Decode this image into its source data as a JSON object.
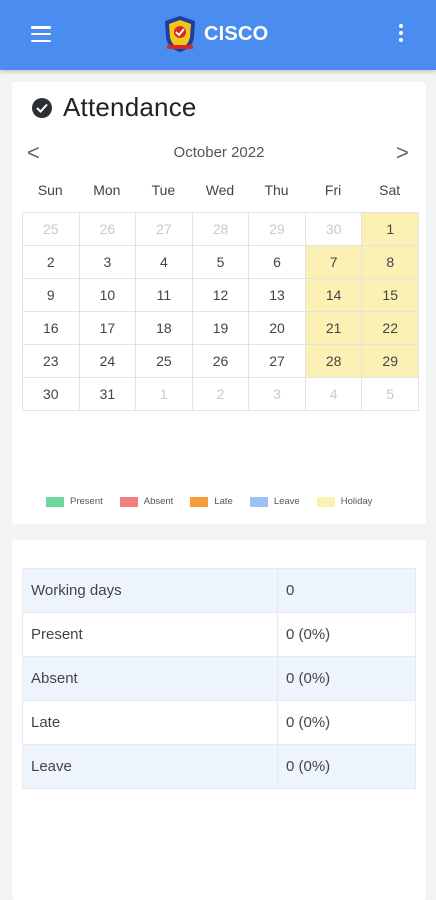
{
  "app": {
    "title": "CISCO"
  },
  "icons": {
    "menu": "hamburger-menu-icon",
    "more": "more-vert-icon",
    "logo": "school-crest-logo",
    "check": "check-circle-icon"
  },
  "attendance": {
    "title": "Attendance",
    "month_label": "October 2022",
    "prev": "<",
    "next": ">",
    "weekdays": [
      "Sun",
      "Mon",
      "Tue",
      "Wed",
      "Thu",
      "Fri",
      "Sat"
    ],
    "days": [
      {
        "d": "25",
        "out": true
      },
      {
        "d": "26",
        "out": true
      },
      {
        "d": "27",
        "out": true
      },
      {
        "d": "28",
        "out": true
      },
      {
        "d": "29",
        "out": true
      },
      {
        "d": "30",
        "out": true
      },
      {
        "d": "1",
        "holiday": true
      },
      {
        "d": "2"
      },
      {
        "d": "3"
      },
      {
        "d": "4"
      },
      {
        "d": "5"
      },
      {
        "d": "6"
      },
      {
        "d": "7",
        "holiday": true
      },
      {
        "d": "8",
        "holiday": true
      },
      {
        "d": "9"
      },
      {
        "d": "10"
      },
      {
        "d": "11"
      },
      {
        "d": "12"
      },
      {
        "d": "13"
      },
      {
        "d": "14",
        "holiday": true
      },
      {
        "d": "15",
        "holiday": true
      },
      {
        "d": "16"
      },
      {
        "d": "17"
      },
      {
        "d": "18"
      },
      {
        "d": "19"
      },
      {
        "d": "20"
      },
      {
        "d": "21",
        "holiday": true
      },
      {
        "d": "22",
        "holiday": true
      },
      {
        "d": "23"
      },
      {
        "d": "24"
      },
      {
        "d": "25"
      },
      {
        "d": "26"
      },
      {
        "d": "27"
      },
      {
        "d": "28",
        "holiday": true
      },
      {
        "d": "29",
        "holiday": true
      },
      {
        "d": "30"
      },
      {
        "d": "31"
      },
      {
        "d": "1",
        "out": true
      },
      {
        "d": "2",
        "out": true
      },
      {
        "d": "3",
        "out": true
      },
      {
        "d": "4",
        "out": true
      },
      {
        "d": "5",
        "out": true
      }
    ],
    "legend": [
      {
        "label": "Present",
        "color": "#6fd6a0"
      },
      {
        "label": "Absent",
        "color": "#f08080"
      },
      {
        "label": "Late",
        "color": "#f59a3d"
      },
      {
        "label": "Leave",
        "color": "#9cc1f3"
      },
      {
        "label": "Holiday",
        "color": "#fcf1b5"
      }
    ]
  },
  "summary": {
    "rows": [
      {
        "label": "Working days",
        "value": "0"
      },
      {
        "label": "Present",
        "value": "0 (0%)"
      },
      {
        "label": "Absent",
        "value": "0 (0%)"
      },
      {
        "label": "Late",
        "value": "0 (0%)"
      },
      {
        "label": "Leave",
        "value": "0 (0%)"
      }
    ]
  }
}
